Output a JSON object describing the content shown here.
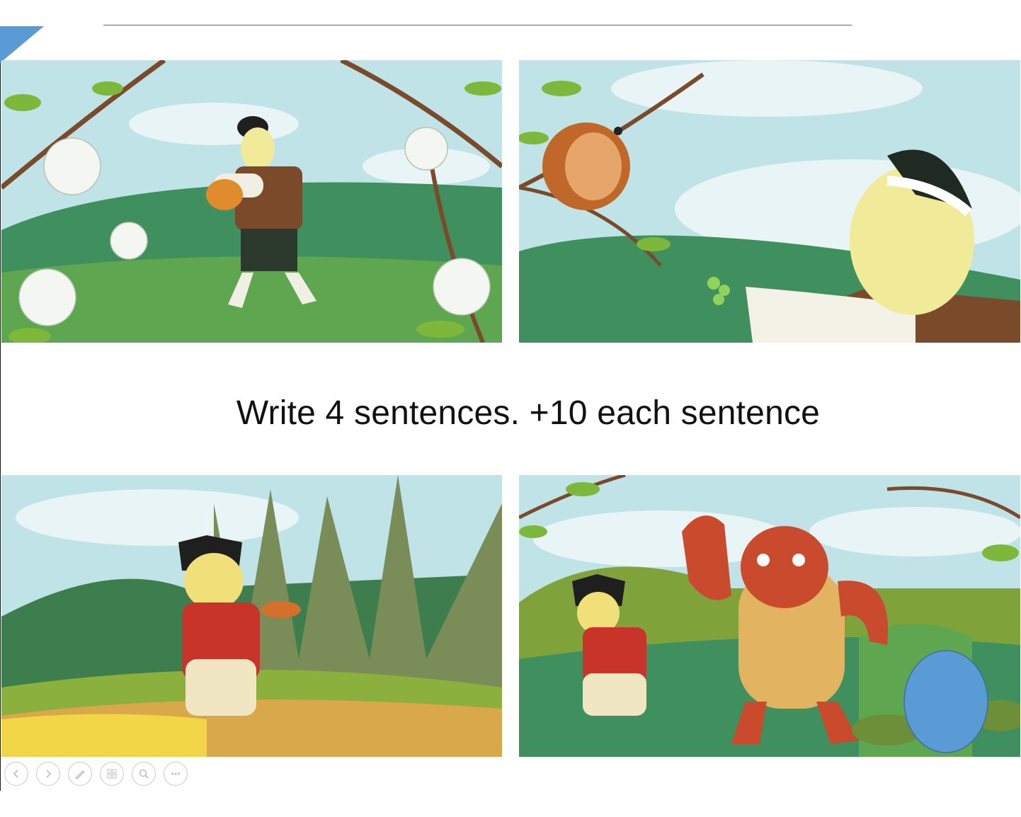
{
  "slide": {
    "instruction": "Write 4 sentences. +10 each sentence",
    "panels": [
      {
        "scene": "man-holding-bird"
      },
      {
        "scene": "bird-on-branch-man-offering-seeds"
      },
      {
        "scene": "man-with-bird-in-grass"
      },
      {
        "scene": "oni-demon-and-man"
      }
    ]
  },
  "toolbar": {
    "buttons": [
      {
        "icon": "previous-icon"
      },
      {
        "icon": "next-icon"
      },
      {
        "icon": "pen-icon"
      },
      {
        "icon": "slides-grid-icon"
      },
      {
        "icon": "zoom-icon"
      },
      {
        "icon": "more-icon"
      }
    ]
  },
  "colors": {
    "sky": "#bfe3e6",
    "hill": "#3f8f5f",
    "accent_corner": "#5b9bd5",
    "oval": "#5b9bd5",
    "demon": "#c94a2c"
  }
}
